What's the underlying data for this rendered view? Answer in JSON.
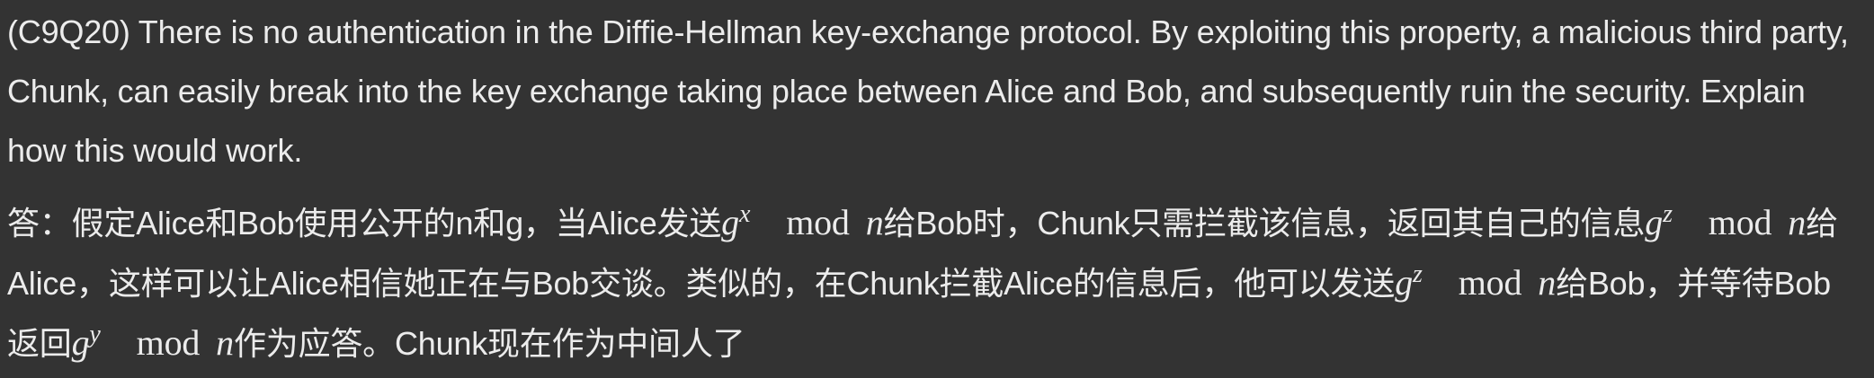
{
  "question": {
    "text": "(C9Q20) There is no authentication in the Diffie-Hellman key-exchange protocol. By exploiting this property, a malicious third party, Chunk, can easily break into the key exchange taking place between Alice and Bob, and subsequently ruin the security. Explain how this would work."
  },
  "answer": {
    "seg1": "答：假定Alice和Bob使用公开的n和g，当Alice发送",
    "m1_base": "g",
    "m1_exp": "x",
    "mod_op": "mod",
    "mod_n": "n",
    "seg2": "给Bob时，Chunk只需拦截该信息，返回其自己的信息",
    "m2_base": "g",
    "m2_exp": "z",
    "seg3": "给Alice，这样可以让Alice相信她正在与Bob交谈。类似的，在Chunk拦截Alice的信息后，他可以发送",
    "m3_base": "g",
    "m3_exp": "z",
    "seg4": "给Bob，并等待Bob返回",
    "m4_base": "g",
    "m4_exp": "y",
    "seg5": "作为应答。Chunk现在作为中间人了"
  },
  "colors": {
    "background": "#333333",
    "text": "#ececec"
  }
}
